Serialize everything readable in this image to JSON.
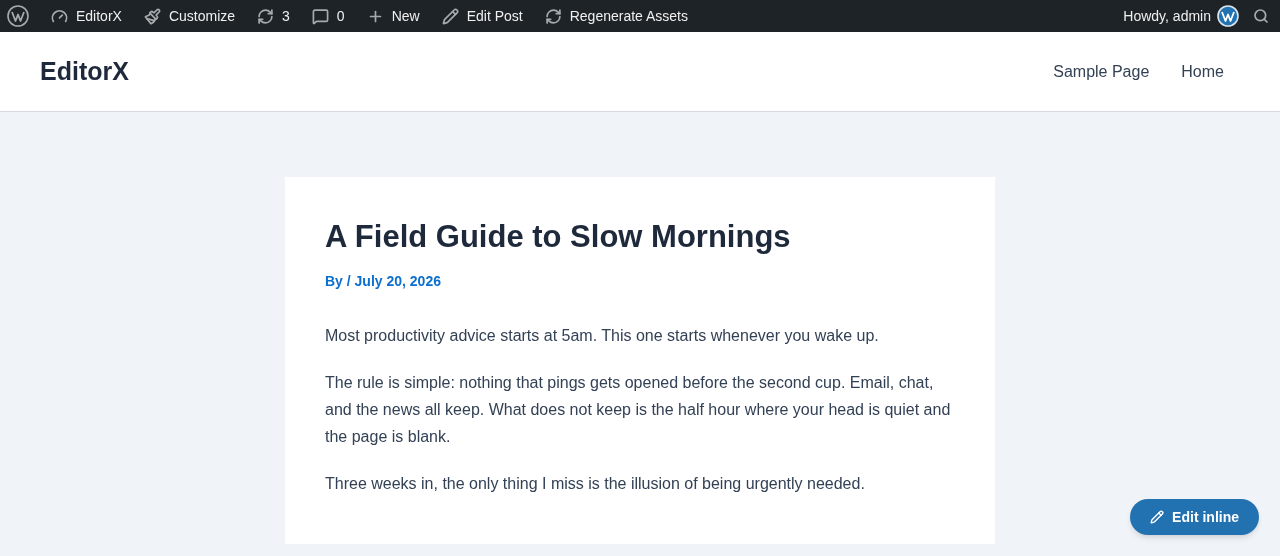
{
  "admin_bar": {
    "items": [
      {
        "kind": "dashboard",
        "label": "EditorX"
      },
      {
        "kind": "customize",
        "label": "Customize"
      },
      {
        "kind": "updates",
        "label": "3"
      },
      {
        "kind": "comments",
        "label": "0"
      },
      {
        "kind": "new",
        "label": "New"
      },
      {
        "kind": "edit",
        "label": "Edit Post"
      },
      {
        "kind": "regenerate",
        "label": "Regenerate Assets"
      }
    ],
    "greeting": "Howdy, admin"
  },
  "header": {
    "site_title": "EditorX",
    "nav": [
      {
        "label": "Sample Page"
      },
      {
        "label": "Home"
      }
    ]
  },
  "post": {
    "title": "A Field Guide to Slow Mornings",
    "meta": "By / July 20, 2026",
    "paragraphs": [
      "Most productivity advice starts at 5am. This one starts whenever you wake up.",
      "The rule is simple: nothing that pings gets opened before the second cup. Email, chat, and the news all keep. What does not keep is the half hour where your head is quiet and the page is blank.",
      "Three weeks in, the only thing I miss is the illusion of being urgently needed."
    ]
  },
  "edit_button": {
    "label": "Edit inline"
  }
}
